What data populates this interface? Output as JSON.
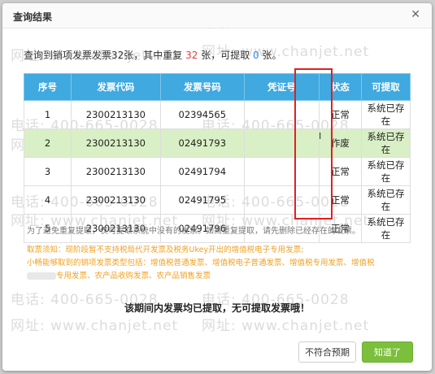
{
  "dialog": {
    "title": "查询结果",
    "close_glyph": "✕"
  },
  "watermarks": {
    "phone": "电话: 400-665-0028",
    "site": "网址: www.chanjet.net"
  },
  "summary": {
    "prefix": "查询到销项发票发票32张，其中重复 ",
    "duplicate": "32",
    "middle": " 张，可提取 ",
    "extractable": "0",
    "suffix": " 张。"
  },
  "table": {
    "headers": [
      "序号",
      "发票代码",
      "发票号码",
      "凭证号",
      "状态",
      "可提取"
    ],
    "rows": [
      {
        "seq": "1",
        "code": "2300213130",
        "number": "02394565",
        "voucher": "",
        "status": "正常",
        "extract": "系统已存在"
      },
      {
        "seq": "2",
        "code": "2300213130",
        "number": "02491793",
        "voucher": "",
        "status": "作废",
        "extract": "系统已存在"
      },
      {
        "seq": "3",
        "code": "2300213130",
        "number": "02491794",
        "voucher": "",
        "status": "正常",
        "extract": "系统已存在"
      },
      {
        "seq": "4",
        "code": "2300213130",
        "number": "02491795",
        "voucher": "",
        "status": "正常",
        "extract": "系统已存在"
      },
      {
        "seq": "5",
        "code": "2300213130",
        "number": "02491796",
        "voucher": "",
        "status": "正常",
        "extract": "系统已存在"
      }
    ]
  },
  "note": "为了避免重复提取，仅可提取系统中没有的发票。如需重复提取，请先删除已经存在的发票。",
  "tips": {
    "line1": "取票须知：现阶段暂不支持税局代开发票及税务Ukey开出的增值税电子专用发票;",
    "line2": "小畅能够取到的销项发票类型包括：增值税普通发票、增值税电子普通发票、增值税专用发票、增值税",
    "line2_tail": "专用发票、农产品收购发票、农产品销售发票"
  },
  "message": "该期间内发票均已提取，无可提取发票哦！",
  "buttons": {
    "secondary": "不符合预期",
    "primary": "知道了"
  },
  "colors": {
    "header_bg": "#3fa9e0",
    "highlight_row": "#d9efc5",
    "primary_button": "#7bbf3c",
    "accent_red": "#e23c3c",
    "accent_blue": "#2a8de0",
    "tips_orange": "#f0a020"
  }
}
